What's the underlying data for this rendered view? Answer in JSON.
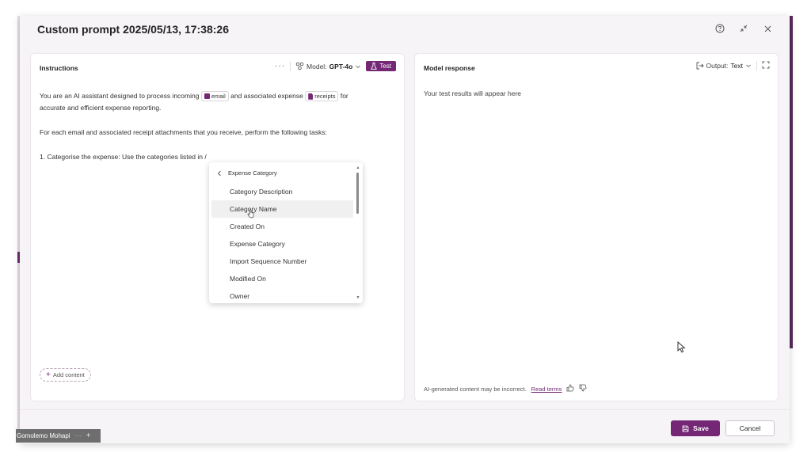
{
  "dialog": {
    "title": "Custom prompt 2025/05/13, 17:38:26"
  },
  "instructions": {
    "title": "Instructions",
    "more": "···",
    "model_label": "Model:",
    "model_value": "GPT-4o",
    "test_label": "Test",
    "line1_a": "You are an AI assistant designed to process incoming",
    "token_email": "email",
    "line1_b": "and associated expense",
    "token_receipts": "receipts",
    "line1_c": "for",
    "line2": "accurate and efficient expense reporting.",
    "line3": "For each email and associated receipt attachments that you receive, perform the following tasks:",
    "line4": "1. Categorise the expense: Use the categories listed in /",
    "add_content": "Add content"
  },
  "dropdown": {
    "back_label": "Expense Category",
    "items": [
      "Category Description",
      "Category Name",
      "Created On",
      "Expense Category",
      "Import Sequence Number",
      "Modified On",
      "Owner"
    ],
    "hovered_index": 1
  },
  "response": {
    "title": "Model response",
    "output_label": "Output:",
    "output_value": "Text",
    "placeholder": "Your test results will appear here",
    "disclaimer": "AI-generated content may be incorrect.",
    "read_terms": "Read terms"
  },
  "footer": {
    "save_label": "Save",
    "cancel_label": "Cancel"
  },
  "taskbar": {
    "user": "Gomolemo Mohapi",
    "dots": "···",
    "plus": "+"
  },
  "colors": {
    "accent": "#742774",
    "dialog_bg": "#f7f4f7"
  },
  "icons": [
    "help-icon",
    "minimize-icon",
    "close-icon",
    "model-icon",
    "flask-icon",
    "output-icon",
    "expand-icon",
    "chevron-left-icon",
    "thumbs-up-icon",
    "thumbs-down-icon",
    "save-icon"
  ]
}
